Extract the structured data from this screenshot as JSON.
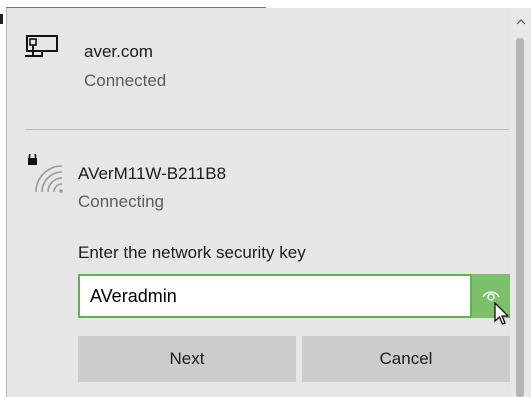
{
  "networks": {
    "connected": {
      "name": "aver.com",
      "status": "Connected",
      "icon": "ethernet-computer-icon"
    },
    "connecting": {
      "name": "AVerM11W-B211B8",
      "status": "Connecting",
      "icon": "secured-wifi-icon",
      "security_prompt": "Enter the network security key",
      "key_value": "AVeradmin",
      "next_label": "Next",
      "cancel_label": "Cancel"
    }
  },
  "colors": {
    "panel_bg": "#e6e6e6",
    "accent_green": "#5fb34a",
    "reveal_bg": "#7cc06a",
    "button_bg": "#cccccc"
  }
}
